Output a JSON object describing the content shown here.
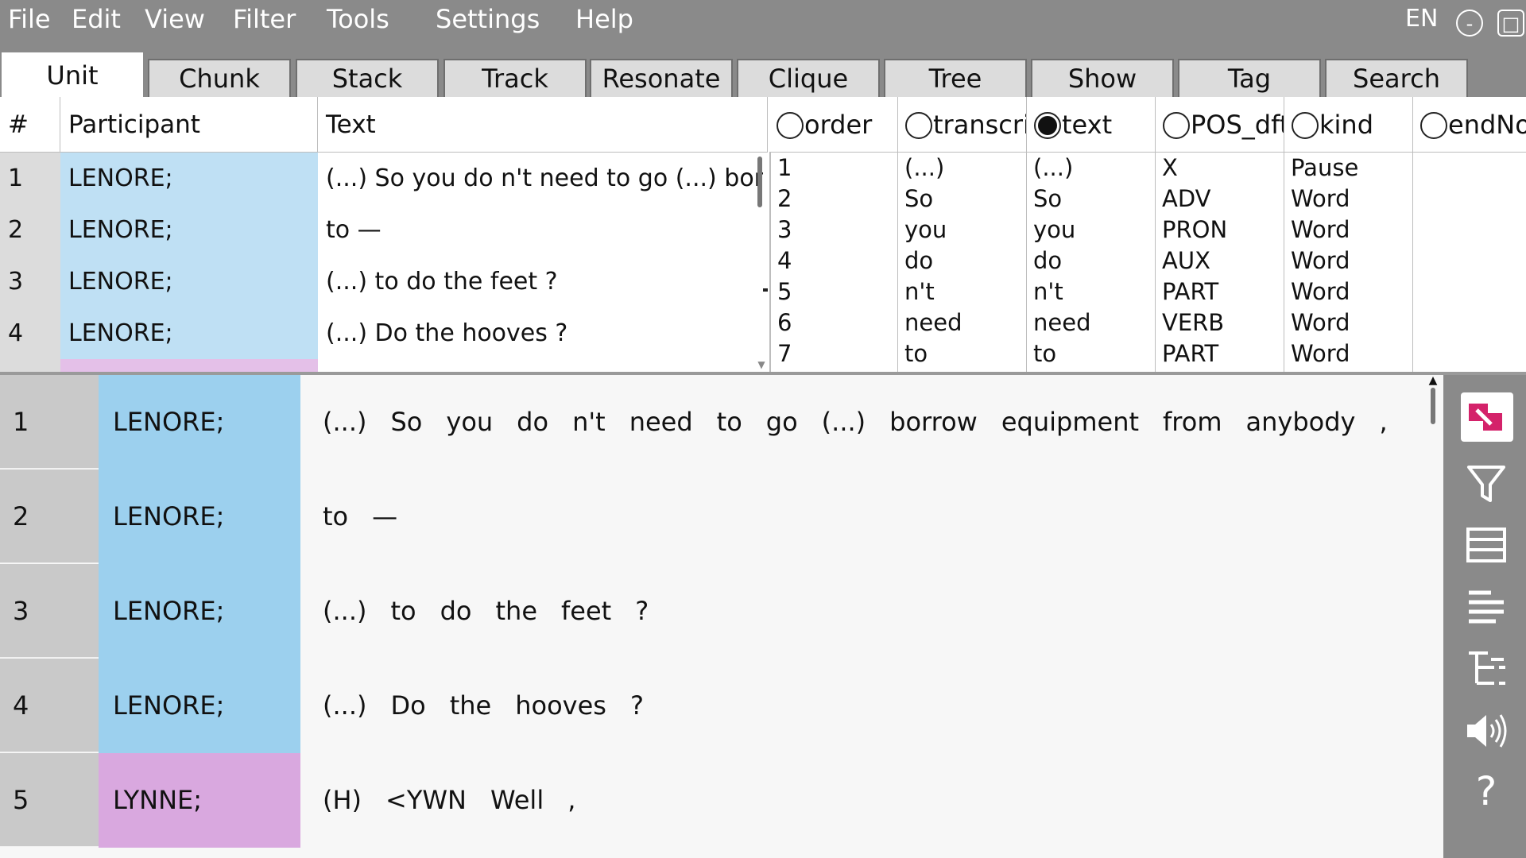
{
  "menu": [
    "File",
    "Edit",
    "View",
    "Filter",
    "Tools",
    "Settings",
    "Help"
  ],
  "language": "EN",
  "window_controls": {
    "minimize": "-",
    "maximize": "□"
  },
  "tabs": [
    "Unit",
    "Chunk",
    "Stack",
    "Track",
    "Resonate",
    "Clique",
    "Tree",
    "Show",
    "Tag",
    "Search"
  ],
  "active_tab": "Unit",
  "unit_table": {
    "headers": {
      "num": "#",
      "participant": "Participant",
      "text": "Text"
    },
    "rows": [
      {
        "num": "1",
        "participant": "LENORE;",
        "text": "(...) So you do n't need to go (...) borrow equipment from anybody ,"
      },
      {
        "num": "2",
        "participant": "LENORE;",
        "text": "to —"
      },
      {
        "num": "3",
        "participant": "LENORE;",
        "text": "(...) to do the feet ?"
      },
      {
        "num": "4",
        "participant": "LENORE;",
        "text": "(...) Do the hooves ?"
      },
      {
        "num": "5",
        "participant": "LYNNE;",
        "text": "(H) <YWN Well ,"
      }
    ]
  },
  "token_table": {
    "columns": [
      {
        "label": "order",
        "selected": false,
        "values": [
          "1",
          "2",
          "3",
          "4",
          "5",
          "6",
          "7"
        ]
      },
      {
        "label": "transcri",
        "selected": false,
        "values": [
          "(...)",
          "So",
          "you",
          "do",
          "n't",
          "need",
          "to"
        ]
      },
      {
        "label": "text",
        "selected": true,
        "values": [
          "(...)",
          "So",
          "you",
          "do",
          "n't",
          "need",
          "to"
        ]
      },
      {
        "label": "POS_dft",
        "selected": false,
        "values": [
          "X",
          "ADV",
          "PRON",
          "AUX",
          "PART",
          "VERB",
          "PART"
        ]
      },
      {
        "label": "kind",
        "selected": false,
        "values": [
          "Pause",
          "Word",
          "Word",
          "Word",
          "Word",
          "Word",
          "Word"
        ]
      },
      {
        "label": "endNo",
        "selected": false,
        "values": []
      }
    ]
  },
  "detail_rows": [
    {
      "num": "1",
      "participant": "LENORE;",
      "tokens": [
        "(...)",
        "So",
        "you",
        "do",
        "n't",
        "need",
        "to",
        "go",
        "(...)",
        "borrow",
        "equipment",
        "from",
        "anybody",
        ","
      ]
    },
    {
      "num": "2",
      "participant": "LENORE;",
      "tokens": [
        "to",
        "—"
      ]
    },
    {
      "num": "3",
      "participant": "LENORE;",
      "tokens": [
        "(...)",
        "to",
        "do",
        "the",
        "feet",
        "?"
      ]
    },
    {
      "num": "4",
      "participant": "LENORE;",
      "tokens": [
        "(...)",
        "Do",
        "the",
        "hooves",
        "?"
      ]
    },
    {
      "num": "5",
      "participant": "LYNNE;",
      "tokens": [
        "(H)",
        "<YWN",
        "Well",
        ","
      ]
    }
  ],
  "toolbar": {
    "help_label": "?",
    "icons": [
      "app-logo-icon",
      "filter-icon",
      "table-icon",
      "align-left-icon",
      "tree-icon",
      "speaker-icon",
      "help-icon"
    ]
  },
  "colors": {
    "chrome": "#8a8a8a",
    "lenore": "#bfe0f4",
    "lenore_detail": "#9cd0ee",
    "lynne": "#e4c0e8",
    "lynne_detail": "#d9a8df",
    "logo": "#d4226a"
  }
}
